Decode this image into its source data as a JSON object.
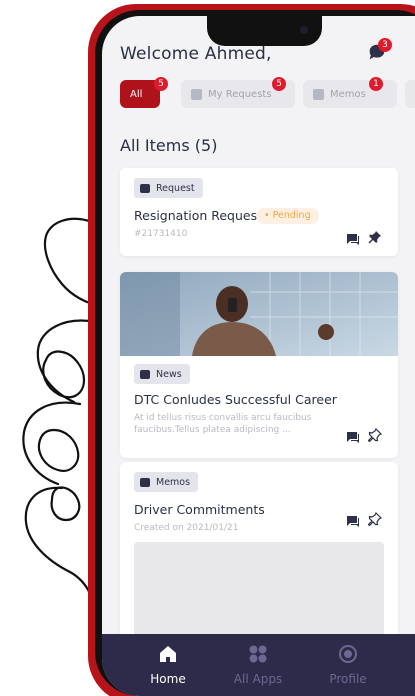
{
  "header": {
    "welcome": "Welcome Ahmed,",
    "chat_badge": "3"
  },
  "tabs": [
    {
      "label": "All",
      "badge": "5",
      "active": true
    },
    {
      "label": "My Requests",
      "badge": "5",
      "active": false
    },
    {
      "label": "Memos",
      "badge": "1",
      "active": false
    }
  ],
  "section": {
    "title": "All Items (5)"
  },
  "cards": {
    "request": {
      "chip": "Request",
      "title": "Resignation Request",
      "status": "Pending",
      "id": "#21731410"
    },
    "news": {
      "chip": "News",
      "title": "DTC Conludes Successful Career",
      "excerpt_line1": "At id tellus risus convallis arcu faucibus",
      "excerpt_line2": "faucibus.Tellus platea adipiscing ..."
    },
    "memo": {
      "chip": "Memos",
      "title": "Driver Commitments",
      "created": "Created on 2021/01/21"
    }
  },
  "bottom_nav": [
    {
      "label": "Home",
      "icon": "home-icon",
      "active": true
    },
    {
      "label": "All Apps",
      "icon": "grid-icon",
      "active": false
    },
    {
      "label": "Profile",
      "icon": "profile-icon",
      "active": false
    }
  ],
  "colors": {
    "brand_red": "#b0121c",
    "badge_red": "#e01a2b",
    "nav_bg": "#2e2a4a",
    "pending": "#f1a53f",
    "text_dark": "#2a2f45"
  }
}
